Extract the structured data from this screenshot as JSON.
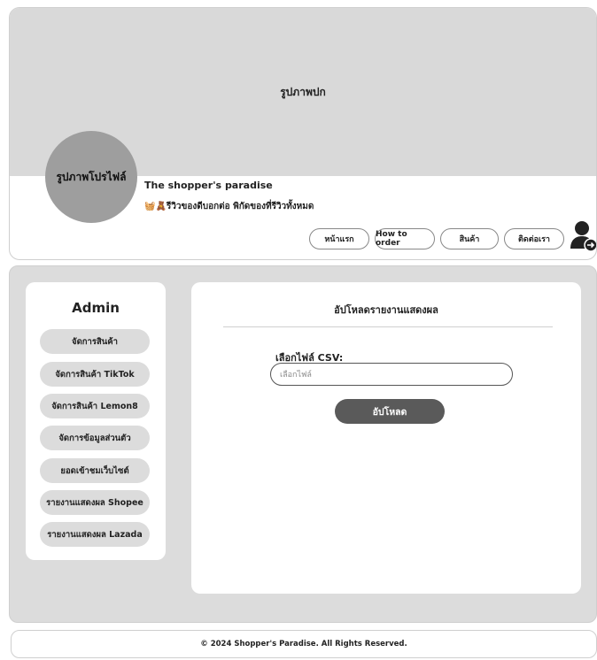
{
  "header": {
    "cover_label": "รูปภาพปก",
    "avatar_label": "รูปภาพโปรไฟล์",
    "shop_name": "The shopper's paradise",
    "tagline": "🧺🧸รีวิวของดีบอกต่อ พิกัดของที่รีวิวทั้งหมด",
    "nav": [
      {
        "label": "หน้าแรก"
      },
      {
        "label": "How to order"
      },
      {
        "label": "สินค้า"
      },
      {
        "label": "ติดต่อเรา"
      }
    ]
  },
  "sidebar": {
    "title": "Admin",
    "items": [
      {
        "label": "จัดการสินค้า"
      },
      {
        "label": "จัดการสินค้า TikTok"
      },
      {
        "label": "จัดการสินค้า Lemon8"
      },
      {
        "label": "จัดการข้อมูลส่วนตัว"
      },
      {
        "label": "ยอดเข้าชมเว็บไซต์"
      },
      {
        "label": "รายงานแสดงผล Shopee"
      },
      {
        "label": "รายงานแสดงผล Lazada"
      }
    ]
  },
  "content": {
    "title": "อัปโหลดรายงานแสดงผล",
    "file_label": "เลือกไฟล์ CSV:",
    "file_placeholder": "เลือกไฟล์",
    "upload_label": "อัปโหลด"
  },
  "footer": {
    "text": "© 2024 Shopper's Paradise. All Rights Reserved."
  }
}
